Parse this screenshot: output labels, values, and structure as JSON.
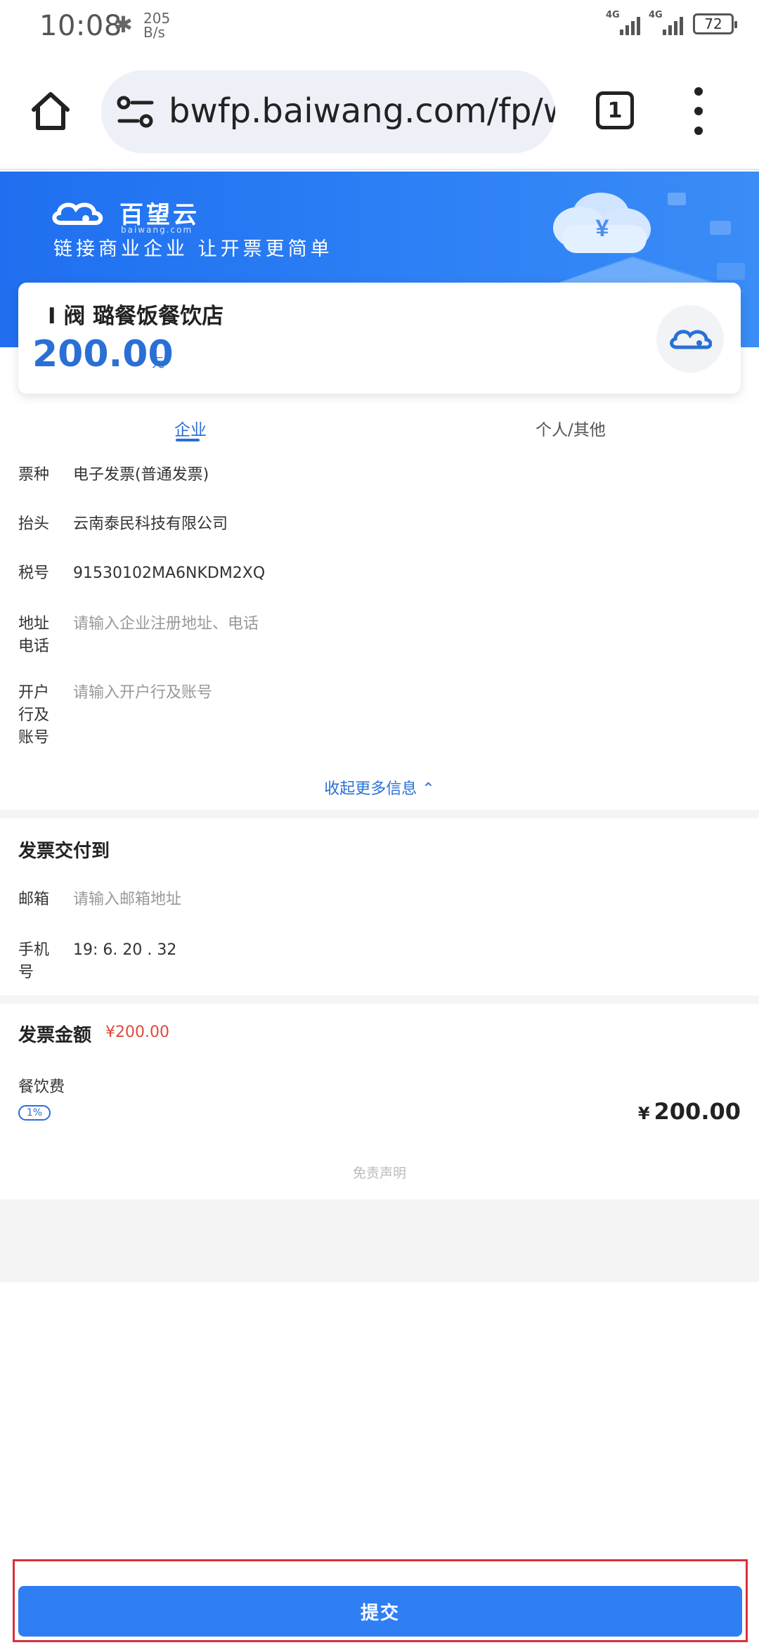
{
  "status_bar": {
    "time": "10:08",
    "bluetooth_icon": "bluetooth-icon",
    "speed_value": "205",
    "speed_unit": "B/s",
    "network_1": "4G",
    "network_2": "4G",
    "battery": "72"
  },
  "browser": {
    "url": "bwfp.baiwang.com/fp/w",
    "tab_count": "1"
  },
  "banner": {
    "logo_name": "百望云",
    "logo_domain": "baiwang.com",
    "slogan": "链接商业企业 让开票更简单"
  },
  "merchant": {
    "name": "I 阀  璐餐饭餐饮店",
    "amount": "200.00",
    "unit": "元"
  },
  "tabs": {
    "company": "企业",
    "other": "个人/其他"
  },
  "form": {
    "invoice_type_label": "票种",
    "invoice_type_value": "电子发票(普通发票)",
    "title_label": "抬头",
    "title_value": "云南泰民科技有限公司",
    "tax_label": "税号",
    "tax_value": "91530102MA6NKDM2XQ",
    "address_label": "地址电话",
    "address_placeholder": "请输入企业注册地址、电话",
    "bank_label": "开户行及账号",
    "bank_placeholder": "请输入开户行及账号",
    "collapse_label": "收起更多信息 ⌃"
  },
  "delivery": {
    "title": "发票交付到",
    "email_label": "邮箱",
    "email_placeholder": "请输入邮箱地址",
    "phone_label": "手机号",
    "phone_value": "19: 6. 20 . 32"
  },
  "invoice_amount": {
    "title": "发票金额",
    "total": "¥200.00",
    "item_name": "餐饮费",
    "rate": "1%",
    "item_currency": "¥",
    "item_amount": "200.00",
    "disclaimer": "免责声明"
  },
  "submit": {
    "label": "提交"
  },
  "colors": {
    "accent": "#2a6fd6",
    "button": "#2f7ef3",
    "highlight_frame": "#d9303a",
    "amount_red": "#e0493c"
  }
}
